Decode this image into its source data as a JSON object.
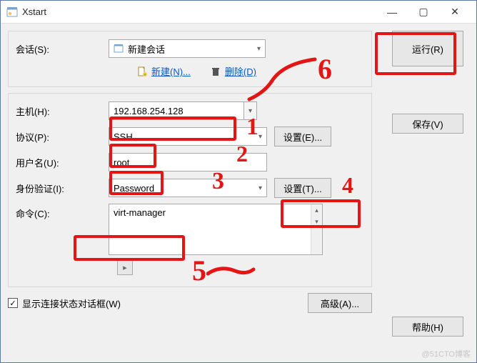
{
  "window": {
    "title": "Xstart"
  },
  "session": {
    "label": "会话(S):",
    "value": "新建会话",
    "new_label": "新建(N)...",
    "delete_label": "删除(D)"
  },
  "buttons": {
    "run": "运行(R)",
    "save": "保存(V)",
    "help": "帮助(H)",
    "advanced": "高级(A)...",
    "settings_e": "设置(E)...",
    "settings_t": "设置(T)..."
  },
  "fields": {
    "host_label": "主机(H):",
    "host_value": "192.168.254.128",
    "proto_label": "协议(P):",
    "proto_value": "SSH",
    "user_label": "用户名(U):",
    "user_value": "root",
    "auth_label": "身份验证(I):",
    "auth_value": "Password",
    "cmd_label": "命令(C):",
    "cmd_value": "virt-manager"
  },
  "checkbox": {
    "label": "显示连接状态对话框(W)",
    "checked": true
  },
  "watermark": "@51CTO博客",
  "annotations": {
    "n1": "1",
    "n2": "2",
    "n3": "3",
    "n4": "4",
    "n5": "5",
    "n6": "6"
  }
}
